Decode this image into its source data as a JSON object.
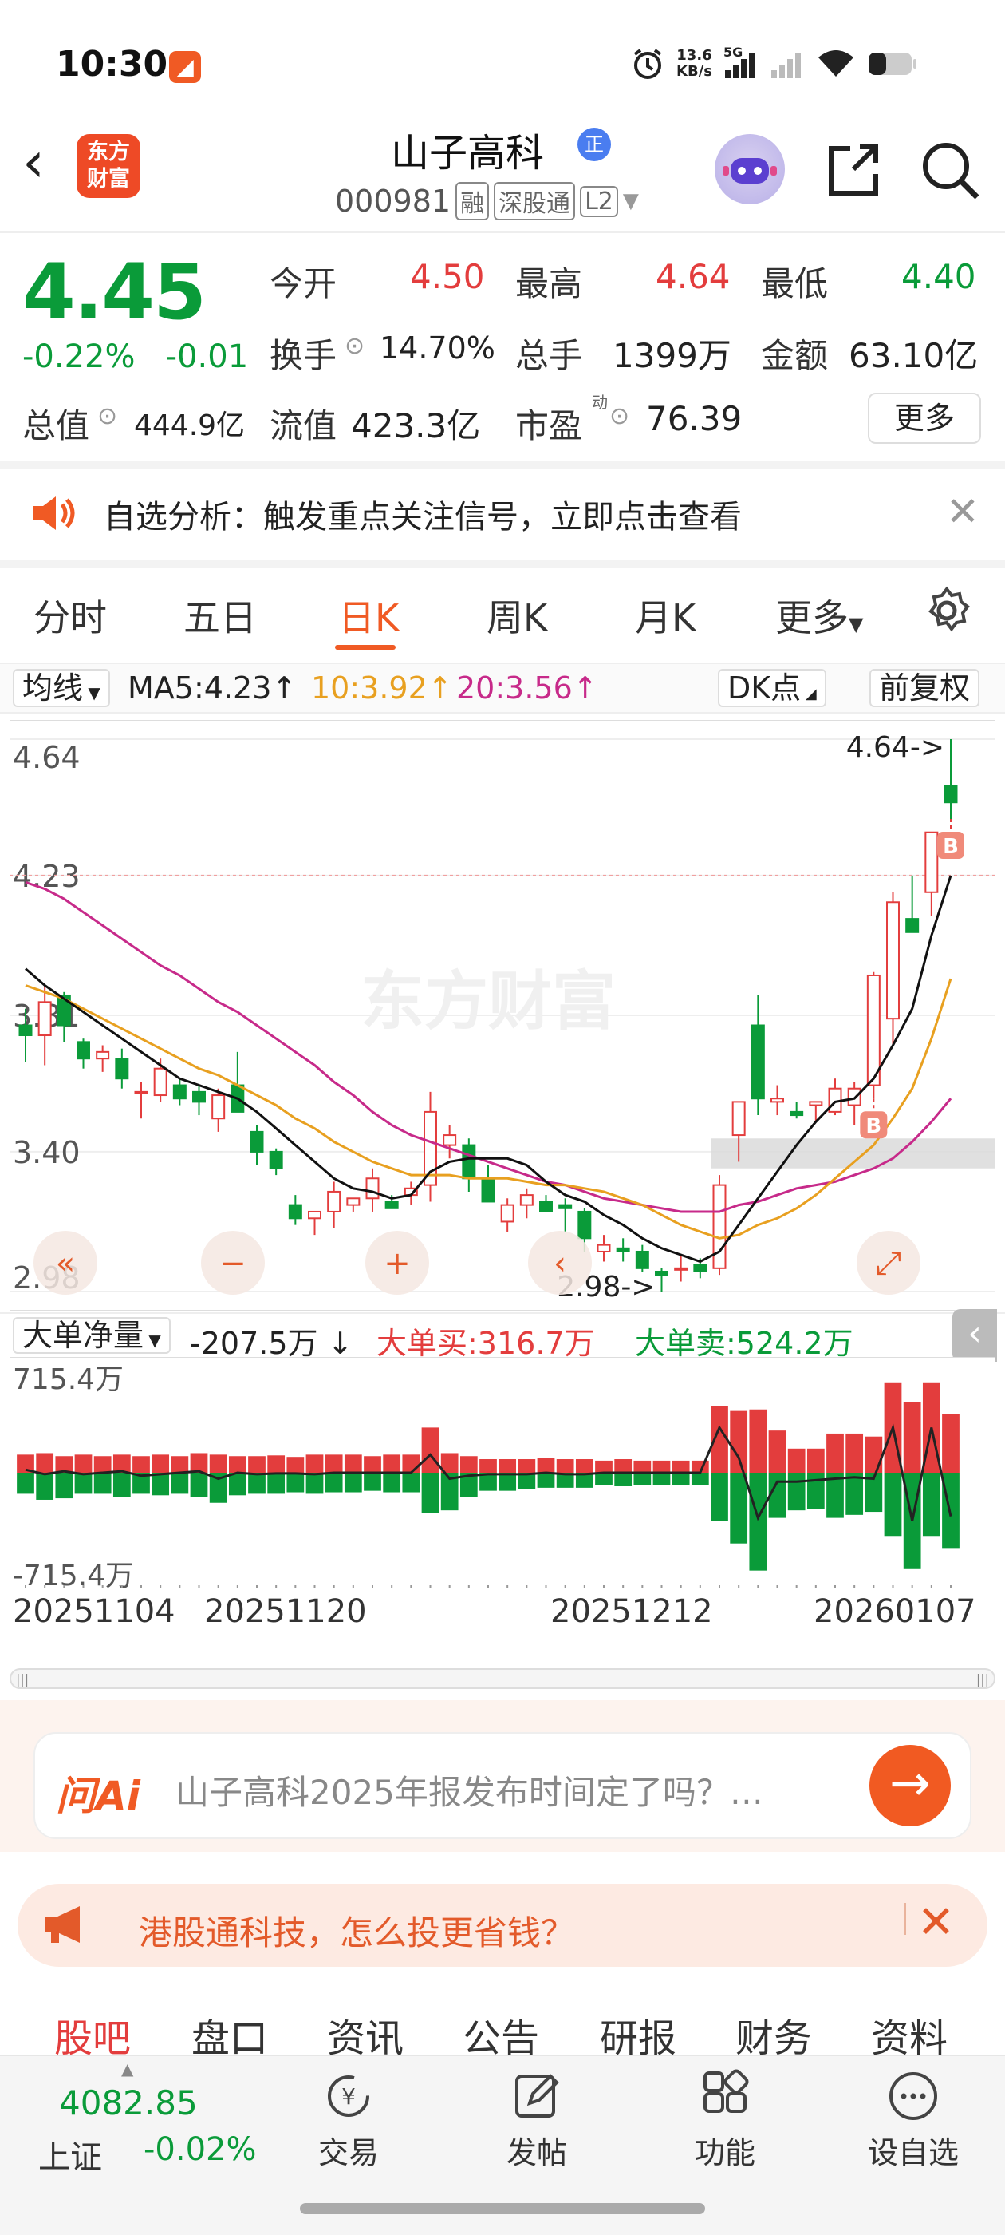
{
  "status_bar": {
    "time": "10:30",
    "net_speed_top": "13.6",
    "net_speed_bottom": "KB/s",
    "sim": "5G"
  },
  "header": {
    "logo_line1": "东方",
    "logo_line2": "财富",
    "title": "山子高科",
    "title_badge": "正",
    "code": "000981",
    "tags": [
      "融",
      "深股通",
      "L2"
    ]
  },
  "quote": {
    "price": "4.45",
    "change_pct": "-0.22%",
    "change": "-0.01",
    "open_label": "今开",
    "open": "4.50",
    "high_label": "最高",
    "high": "4.64",
    "low_label": "最低",
    "low": "4.40",
    "turnover_label": "换手",
    "turnover": "14.70%",
    "volume_label": "总手",
    "volume": "1399万",
    "amount_label": "金额",
    "amount": "63.10亿",
    "mktcap_label": "总值",
    "mktcap": "444.9亿",
    "float_label": "流值",
    "float_cap": "423.3亿",
    "pe_label": "市盈",
    "pe_sup": "动",
    "pe": "76.39",
    "more": "更多"
  },
  "alert": {
    "text": "自选分析：触发重点关注信号，立即点击查看"
  },
  "tabs": [
    "分时",
    "五日",
    "日K",
    "周K",
    "月K",
    "更多"
  ],
  "ma_bar": {
    "selector": "均线",
    "ma5": "MA5:4.23",
    "ma10": "10:3.92",
    "ma20": "20:3.56",
    "dk": "DK点",
    "adjust": "前复权"
  },
  "colors": {
    "up": "#e33d3d",
    "down": "#0a9b39",
    "ma5": "#111111",
    "ma10": "#e8a020",
    "ma20": "#c72a8a",
    "accent": "#f05a24"
  },
  "chart_data": [
    {
      "type": "candlestick",
      "title": "",
      "y_ticks": [
        "4.64",
        "4.23",
        "3.81",
        "3.40",
        "2.98"
      ],
      "ylim": [
        2.98,
        4.64
      ],
      "x_ticks": [
        "20251104",
        "20251120",
        "20251212",
        "20260107"
      ],
      "high_label": "4.64->",
      "low_label": "2.98->",
      "candles": [
        [
          3.78,
          3.83,
          3.67,
          3.75
        ],
        [
          3.75,
          3.9,
          3.66,
          3.85
        ],
        [
          3.87,
          3.88,
          3.73,
          3.78
        ],
        [
          3.73,
          3.74,
          3.65,
          3.68
        ],
        [
          3.68,
          3.72,
          3.64,
          3.7
        ],
        [
          3.68,
          3.71,
          3.59,
          3.62
        ],
        [
          3.58,
          3.61,
          3.5,
          3.58
        ],
        [
          3.57,
          3.68,
          3.55,
          3.65
        ],
        [
          3.6,
          3.62,
          3.54,
          3.56
        ],
        [
          3.58,
          3.6,
          3.51,
          3.55
        ],
        [
          3.5,
          3.59,
          3.46,
          3.57
        ],
        [
          3.6,
          3.7,
          3.53,
          3.52
        ],
        [
          3.46,
          3.48,
          3.36,
          3.4
        ],
        [
          3.4,
          3.41,
          3.33,
          3.35
        ],
        [
          3.24,
          3.27,
          3.18,
          3.2
        ],
        [
          3.2,
          3.22,
          3.15,
          3.22
        ],
        [
          3.22,
          3.31,
          3.17,
          3.28
        ],
        [
          3.24,
          3.26,
          3.22,
          3.26
        ],
        [
          3.26,
          3.35,
          3.22,
          3.32
        ],
        [
          3.25,
          3.27,
          3.23,
          3.23
        ],
        [
          3.27,
          3.31,
          3.24,
          3.29
        ],
        [
          3.3,
          3.58,
          3.25,
          3.52
        ],
        [
          3.42,
          3.48,
          3.38,
          3.45
        ],
        [
          3.42,
          3.44,
          3.28,
          3.32
        ],
        [
          3.32,
          3.36,
          3.25,
          3.25
        ],
        [
          3.19,
          3.26,
          3.16,
          3.24
        ],
        [
          3.24,
          3.29,
          3.2,
          3.27
        ],
        [
          3.25,
          3.27,
          3.22,
          3.22
        ],
        [
          3.24,
          3.26,
          3.16,
          3.23
        ],
        [
          3.22,
          3.23,
          3.1,
          3.14
        ],
        [
          3.1,
          3.15,
          3.07,
          3.12
        ],
        [
          3.11,
          3.14,
          3.07,
          3.1
        ],
        [
          3.1,
          3.12,
          3.04,
          3.05
        ],
        [
          3.04,
          3.05,
          2.98,
          3.03
        ],
        [
          3.05,
          3.09,
          3.01,
          3.05
        ],
        [
          3.06,
          3.08,
          3.02,
          3.04
        ],
        [
          3.05,
          3.33,
          3.03,
          3.3
        ],
        [
          3.45,
          3.52,
          3.37,
          3.55
        ],
        [
          3.78,
          3.87,
          3.51,
          3.56
        ],
        [
          3.55,
          3.6,
          3.51,
          3.56
        ],
        [
          3.52,
          3.55,
          3.5,
          3.51
        ],
        [
          3.54,
          3.55,
          3.49,
          3.55
        ],
        [
          3.52,
          3.62,
          3.51,
          3.59
        ],
        [
          3.54,
          3.61,
          3.48,
          3.59
        ],
        [
          3.6,
          3.94,
          3.56,
          3.93
        ],
        [
          3.8,
          4.18,
          3.72,
          4.15
        ],
        [
          4.1,
          4.23,
          4.06,
          4.06
        ],
        [
          4.18,
          4.36,
          4.11,
          4.36
        ],
        [
          4.5,
          4.64,
          4.4,
          4.45
        ]
      ],
      "ma5": [
        3.95,
        3.9,
        3.86,
        3.82,
        3.78,
        3.74,
        3.7,
        3.66,
        3.62,
        3.6,
        3.58,
        3.56,
        3.52,
        3.47,
        3.42,
        3.37,
        3.32,
        3.29,
        3.28,
        3.26,
        3.27,
        3.34,
        3.37,
        3.38,
        3.38,
        3.38,
        3.36,
        3.31,
        3.27,
        3.25,
        3.21,
        3.18,
        3.14,
        3.11,
        3.09,
        3.07,
        3.1,
        3.18,
        3.26,
        3.34,
        3.42,
        3.49,
        3.55,
        3.56,
        3.62,
        3.72,
        3.83,
        4.05,
        4.23
      ],
      "ma10": [
        3.9,
        3.88,
        3.86,
        3.83,
        3.8,
        3.77,
        3.74,
        3.71,
        3.68,
        3.65,
        3.63,
        3.6,
        3.57,
        3.54,
        3.5,
        3.47,
        3.43,
        3.4,
        3.37,
        3.35,
        3.33,
        3.33,
        3.33,
        3.32,
        3.32,
        3.32,
        3.31,
        3.3,
        3.3,
        3.29,
        3.28,
        3.26,
        3.24,
        3.21,
        3.18,
        3.16,
        3.14,
        3.15,
        3.18,
        3.2,
        3.23,
        3.27,
        3.32,
        3.37,
        3.42,
        3.5,
        3.59,
        3.74,
        3.92
      ],
      "ma20": [
        4.21,
        4.19,
        4.16,
        4.12,
        4.08,
        4.04,
        4.0,
        3.96,
        3.93,
        3.89,
        3.85,
        3.82,
        3.78,
        3.74,
        3.7,
        3.66,
        3.61,
        3.57,
        3.52,
        3.48,
        3.45,
        3.43,
        3.41,
        3.39,
        3.37,
        3.35,
        3.33,
        3.31,
        3.3,
        3.28,
        3.26,
        3.25,
        3.24,
        3.23,
        3.22,
        3.22,
        3.22,
        3.24,
        3.25,
        3.27,
        3.29,
        3.3,
        3.31,
        3.33,
        3.35,
        3.38,
        3.43,
        3.49,
        3.56
      ],
      "markers": [
        {
          "label": "B",
          "candle": 44
        },
        {
          "label": "B",
          "candle": 48
        }
      ]
    },
    {
      "type": "bar",
      "title": "大单净量",
      "summary": "-207.5万 ↓",
      "buy_label": "大单买:316.7万",
      "sell_label": "大单卖:524.2万",
      "y_ticks": [
        "715.4万",
        "-715.4万"
      ],
      "ylim": [
        -715.4,
        715.4
      ],
      "buy": [
        120,
        130,
        110,
        120,
        110,
        120,
        110,
        120,
        110,
        130,
        120,
        110,
        110,
        115,
        105,
        120,
        120,
        120,
        110,
        120,
        120,
        300,
        130,
        110,
        90,
        90,
        90,
        100,
        90,
        90,
        80,
        90,
        80,
        80,
        80,
        80,
        440,
        410,
        420,
        280,
        160,
        160,
        260,
        260,
        240,
        600,
        470,
        600,
        390
      ],
      "sell": [
        -140,
        -180,
        -170,
        -140,
        -140,
        -160,
        -140,
        -150,
        -140,
        -160,
        -200,
        -150,
        -140,
        -140,
        -130,
        -140,
        -130,
        -130,
        -120,
        -130,
        -130,
        -270,
        -250,
        -160,
        -120,
        -120,
        -110,
        -100,
        -100,
        -100,
        -80,
        -90,
        -80,
        -80,
        -80,
        -80,
        -320,
        -470,
        -650,
        -300,
        -250,
        -240,
        -300,
        -280,
        -260,
        -420,
        -640,
        -420,
        -500
      ],
      "net": [
        20,
        -10,
        10,
        -10,
        0,
        10,
        -20,
        -10,
        0,
        10,
        -40,
        0,
        -10,
        -5,
        -5,
        -10,
        0,
        0,
        0,
        0,
        0,
        120,
        -40,
        -20,
        -10,
        -10,
        -10,
        0,
        -10,
        -10,
        0,
        0,
        0,
        0,
        0,
        0,
        300,
        100,
        -300,
        -60,
        -60,
        -50,
        -40,
        -30,
        -40,
        300,
        -320,
        300,
        -290
      ]
    }
  ],
  "chart_controls": [
    "«",
    "−",
    "+",
    "‹",
    "›",
    "⤢"
  ],
  "ask_ai": {
    "logo": "问Ai",
    "text": "山子高科2025年报发布时间定了吗？…"
  },
  "promo": {
    "text": "港股通科技，怎么投更省钱？"
  },
  "bottom_tabs": [
    "股吧",
    "盘口",
    "资讯",
    "公告",
    "研报",
    "财务",
    "资料"
  ],
  "index": {
    "value": "4082.85",
    "name": "上证",
    "change": "-0.02%"
  },
  "nav": [
    "交易",
    "发帖",
    "功能",
    "设自选"
  ]
}
